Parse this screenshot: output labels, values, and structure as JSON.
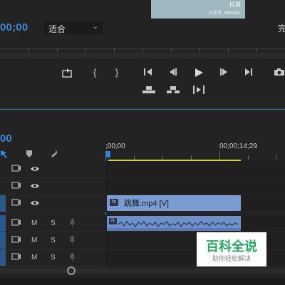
{
  "program_monitor": {
    "video_watermark_line1": "抖音",
    "video_watermark_line2": "抖音号: 8891881",
    "timecode": "00;00",
    "fit_select": "适合",
    "right_edge_text": "完",
    "transport_icons": [
      "export-frame-icon",
      "mark-in-icon",
      "mark-out-icon",
      "go-to-in-icon",
      "step-back-icon",
      "play-icon",
      "step-forward-icon",
      "go-to-out-icon",
      "camera-icon",
      "lift-icon",
      "extract-icon",
      "insert-icon"
    ]
  },
  "timeline": {
    "timecode": "00",
    "ruler_start": ";00;00",
    "ruler_mark": "00;00;14;29",
    "tools": [
      "snap-icon",
      "marker-icon",
      "wrench-icon"
    ],
    "tracks": [
      {
        "id": "V3",
        "type": "video",
        "clip": null
      },
      {
        "id": "V2",
        "type": "video",
        "clip": null
      },
      {
        "id": "V1",
        "type": "video",
        "clip": "跳舞.mp4 [V]",
        "fx": "fx"
      },
      {
        "id": "A1",
        "type": "audio",
        "m": "M",
        "s": "S",
        "clip": "waveform",
        "fx": "fx"
      },
      {
        "id": "A2",
        "type": "audio",
        "m": "M",
        "s": "S",
        "clip": null
      },
      {
        "id": "A3",
        "type": "audio",
        "m": "M",
        "s": "S",
        "clip": null
      }
    ]
  },
  "watermark": {
    "title": "百科全说",
    "subtitle": "助你轻松解决"
  },
  "colors": {
    "accent_blue": "#3b86d6",
    "work_area_yellow": "#d7d12a",
    "video_clip": "#7b9cd0",
    "audio_clip": "#6f8fc7",
    "watermark_green": "#2ba864"
  }
}
